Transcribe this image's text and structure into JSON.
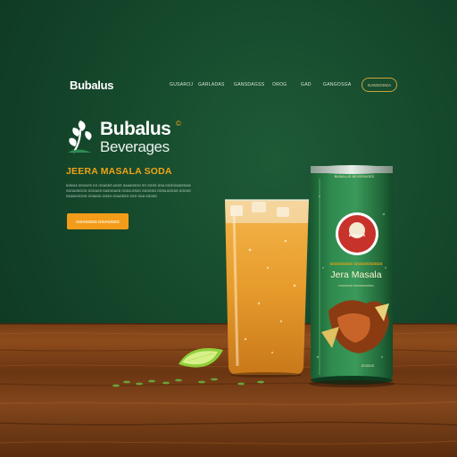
{
  "nav": {
    "logo": "Bubalus",
    "links": [
      "GUSAROJ",
      "GARLADAS",
      "GANSDAGSS",
      "OROG",
      "GAD",
      "GANGOSGA"
    ],
    "cta_label": "GANGOSGA"
  },
  "hero": {
    "brand_name": "Bubalus",
    "brand_sub": "Beverages",
    "registered": "©",
    "title": "JEERA MASALA SODA",
    "copy_lines": [
      "DGNGA GGGAOS GG GGAGDS AGGS GAAAGSGO GG GGGS GGA GGOGGADSGAGS GGGO",
      "GOGAGDGOG GGGAGS GASGGAGD GGGA GSGG GGOGGG GGSA AGGSG GOGGSG",
      "GGADGGOGD GGSAGG GGSG GGAGDSO GGO GGA GGGSG"
    ],
    "cta_label": "GGAGSGG GGAGSGG"
  },
  "product": {
    "can_top_text": "BUBALUS BEVERAGES",
    "can_logo_text": "BUBALUS",
    "can_flavor_sub": "GGGSGGG GGGSGGSGS",
    "can_flavor": "Jera Masala",
    "can_flavor_desc": "GGGSGGG GGGSGGGSGG",
    "can_bottom_text": "GGGSGG"
  },
  "colors": {
    "background": "#134429",
    "accent": "#f39c1a",
    "can_green": "#2d7a45",
    "wood": "#7a3f16"
  }
}
